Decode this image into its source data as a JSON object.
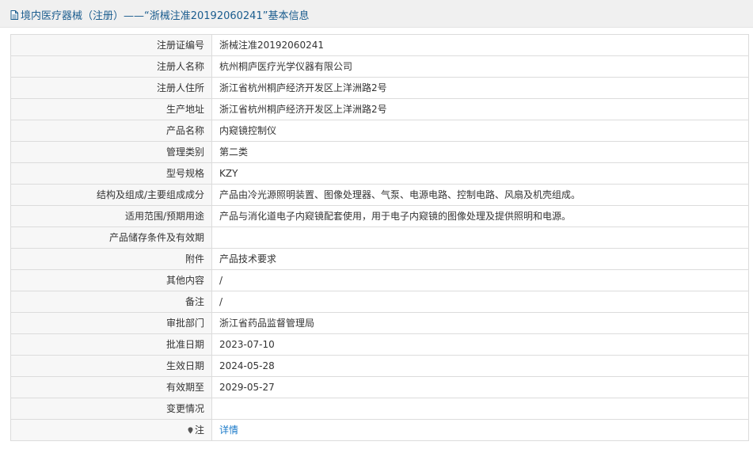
{
  "header": {
    "icon": "document-icon",
    "title": "境内医疗器械（注册）——“浙械注准20192060241”基本信息"
  },
  "rows": [
    {
      "label": "注册证编号",
      "value": "浙械注准20192060241"
    },
    {
      "label": "注册人名称",
      "value": "杭州桐庐医疗光学仪器有限公司"
    },
    {
      "label": "注册人住所",
      "value": "浙江省杭州桐庐经济开发区上洋洲路2号"
    },
    {
      "label": "生产地址",
      "value": "浙江省杭州桐庐经济开发区上洋洲路2号"
    },
    {
      "label": "产品名称",
      "value": "内窥镜控制仪"
    },
    {
      "label": "管理类别",
      "value": "第二类"
    },
    {
      "label": "型号规格",
      "value": "KZY"
    },
    {
      "label": "结构及组成/主要组成成分",
      "value": "产品由冷光源照明装置、图像处理器、气泵、电源电路、控制电路、风扇及机壳组成。"
    },
    {
      "label": "适用范围/预期用途",
      "value": "产品与消化道电子内窥镜配套使用，用于电子内窥镜的图像处理及提供照明和电源。"
    },
    {
      "label": "产品储存条件及有效期",
      "value": ""
    },
    {
      "label": "附件",
      "value": "产品技术要求"
    },
    {
      "label": "其他内容",
      "value": "/"
    },
    {
      "label": "备注",
      "value": "/"
    },
    {
      "label": "审批部门",
      "value": "浙江省药品监督管理局"
    },
    {
      "label": "批准日期",
      "value": "2023-07-10"
    },
    {
      "label": "生效日期",
      "value": "2024-05-28"
    },
    {
      "label": "有效期至",
      "value": "2029-05-27"
    },
    {
      "label": "变更情况",
      "value": ""
    }
  ],
  "note_row": {
    "icon": "pin-icon",
    "label": "注",
    "link_text": "详情"
  },
  "colors": {
    "header_text": "#1a5c8e",
    "link": "#1a7ac9",
    "label_bg": "#f7f7f7",
    "border": "#dcdcdc"
  }
}
